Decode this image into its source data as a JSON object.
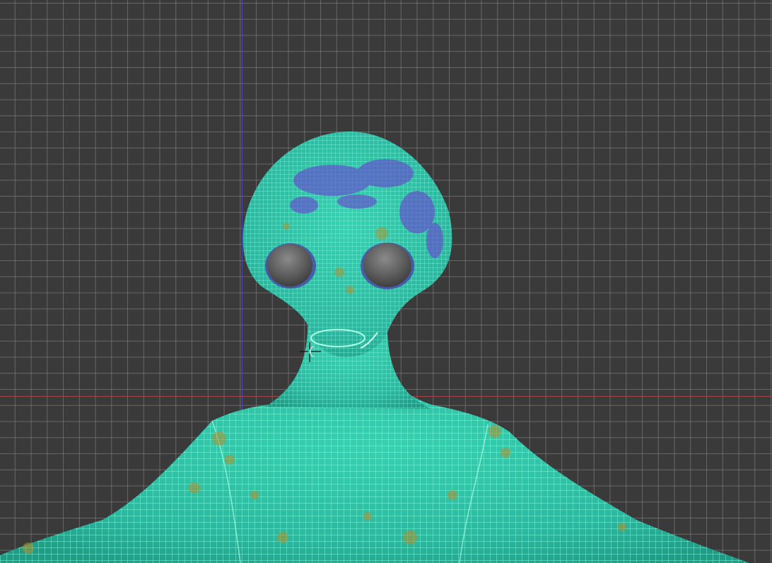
{
  "viewport": {
    "grid_color": "#8c8c8c",
    "background_color": "#3a3a3a",
    "axis_vertical_color": "#4a4aa8",
    "axis_horizontal_color": "#a64545"
  },
  "model": {
    "name_icon": "alien-mesh",
    "display_mode": "wireframe-on-shaded",
    "wire_color": "#7ff5c8",
    "body_color": "#2ec7a8",
    "spot_colors": [
      "#6a3fd0",
      "#b3902a"
    ],
    "eye_color": "#666666"
  },
  "cursor": {
    "icon": "crosshair-cursor-icon"
  }
}
